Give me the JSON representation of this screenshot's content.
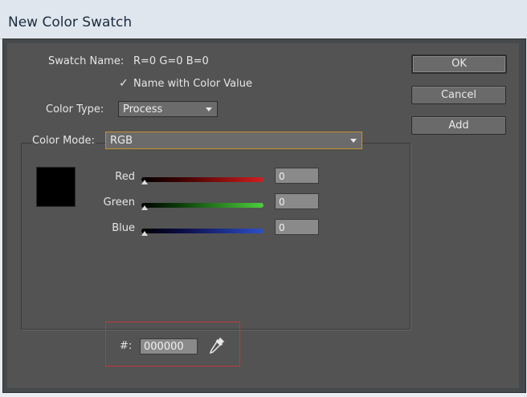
{
  "window": {
    "title": "New Color Swatch"
  },
  "swatch": {
    "name_label": "Swatch Name:",
    "name_value": "R=0 G=0 B=0",
    "name_with_value_label": "Name with Color Value",
    "name_with_value_checked": true
  },
  "color_type": {
    "label": "Color Type:",
    "value": "Process"
  },
  "color_mode": {
    "label": "Color Mode:",
    "value": "RGB"
  },
  "preview_color": "#000000",
  "sliders": [
    {
      "label": "Red",
      "value": "0",
      "color": "#d11e1e"
    },
    {
      "label": "Green",
      "value": "0",
      "color": "#4ccf3c"
    },
    {
      "label": "Blue",
      "value": "0",
      "color": "#2d50c8"
    }
  ],
  "hex": {
    "label": "#:",
    "value": "000000"
  },
  "buttons": {
    "ok": "OK",
    "cancel": "Cancel",
    "add": "Add"
  },
  "icons": {
    "eyedropper": "eyedropper-icon",
    "checkmark": "checkmark-icon",
    "dropdown": "chevron-down-icon"
  }
}
